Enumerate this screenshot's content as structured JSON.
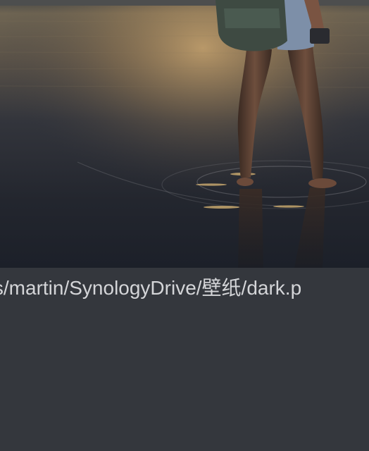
{
  "preview": {
    "image_subject": "Person with backpack standing barefoot in shallow water at dusk",
    "colors": {
      "sky_glow": "#c9a36c",
      "water_dark": "#1f2430",
      "panel_background": "#34373d",
      "path_text": "#d4d5d8"
    }
  },
  "file_path": {
    "text": "ers/martin/SynologyDrive/壁纸/dark.p"
  }
}
